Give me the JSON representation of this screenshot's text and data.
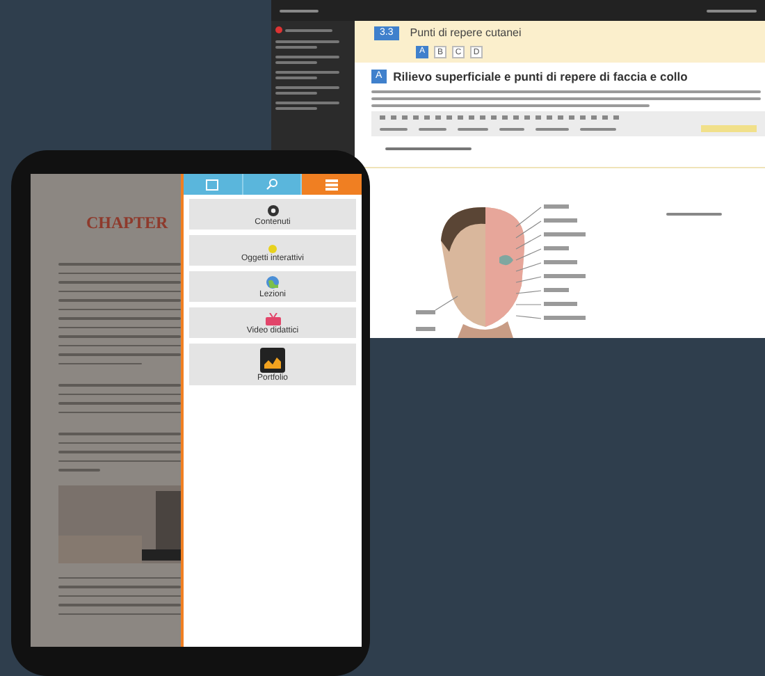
{
  "laptop": {
    "section": {
      "number": "3.3",
      "title": "Punti di repere cutanei",
      "tabs": [
        {
          "label": "A",
          "selected": true
        },
        {
          "label": "B",
          "selected": false
        },
        {
          "label": "C",
          "selected": false
        },
        {
          "label": "D",
          "selected": false
        }
      ]
    },
    "heading": {
      "badge": "A",
      "text": "Rilievo superficiale e punti di repere di faccia e collo"
    },
    "sidebar": [
      {
        "kind": "alert"
      },
      {
        "kind": "plain"
      },
      {
        "kind": "plain"
      },
      {
        "kind": "plain"
      },
      {
        "kind": "plain"
      },
      {
        "kind": "plain"
      }
    ]
  },
  "tablet": {
    "book_title": "CHAPTER",
    "tabs": [
      {
        "kind": "notes",
        "selected": false
      },
      {
        "kind": "search",
        "selected": false
      },
      {
        "kind": "menu",
        "selected": true
      }
    ],
    "menu": [
      {
        "kind": "gear",
        "label": "Contenuti"
      },
      {
        "kind": "dot",
        "label": "Oggetti interattivi"
      },
      {
        "kind": "globe",
        "label": "Lezioni"
      },
      {
        "kind": "video",
        "label": "Video didattici"
      },
      {
        "kind": "chart",
        "label": "Portfolio"
      }
    ]
  }
}
